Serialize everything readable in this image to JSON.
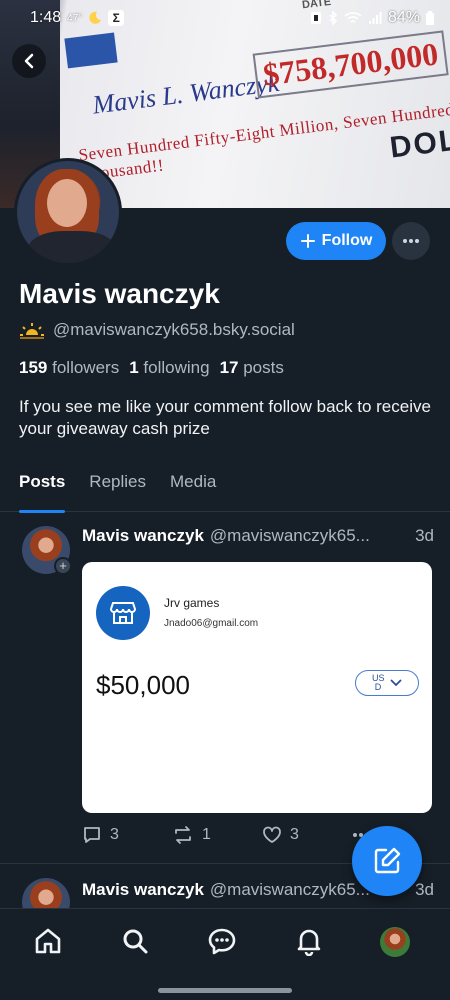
{
  "status_bar": {
    "time": "1:48",
    "temp": "47°",
    "battery": "84%"
  },
  "banner": {
    "check_name": "Mavis L. Wanczyk",
    "check_amount": "$758,700,000",
    "check_words": "Seven Hundred Fifty-Eight Million, Seven Hundred Thousand!!",
    "check_dollars": "DOLLARS",
    "check_date": "DATE"
  },
  "profile": {
    "name": "Mavis wanczyk",
    "handle": "@maviswanczyk658.bsky.social",
    "followers_count": "159",
    "followers_label": "followers",
    "following_count": "1",
    "following_label": "following",
    "posts_count": "17",
    "posts_label": "posts",
    "bio": "If you see me like your comment follow back to receive your giveaway cash prize",
    "follow_label": "Follow"
  },
  "tabs": [
    {
      "label": "Posts",
      "active": true
    },
    {
      "label": "Replies",
      "active": false
    },
    {
      "label": "Media",
      "active": false
    }
  ],
  "posts": [
    {
      "author": "Mavis wanczyk",
      "handle": "@maviswanczyk65...",
      "time": "3d",
      "embed": {
        "store_name": "Jrv games",
        "store_email": "Jnado06@gmail.com",
        "amount": "$50,000",
        "currency_line1": "US",
        "currency_line2": "D"
      },
      "replies": "3",
      "reposts": "1",
      "likes": "3"
    },
    {
      "author": "Mavis wanczyk",
      "handle": "@maviswanczyk65...",
      "time": "3d"
    }
  ],
  "icons": {
    "back": "chevron-left-icon",
    "more": "ellipsis-icon",
    "compose": "compose-icon",
    "home": "home-icon",
    "search": "search-icon",
    "chat": "chat-icon",
    "notifications": "bell-icon"
  },
  "colors": {
    "accent": "#1f84f5",
    "background": "#161e27",
    "muted_text": "#aeb8c4"
  }
}
